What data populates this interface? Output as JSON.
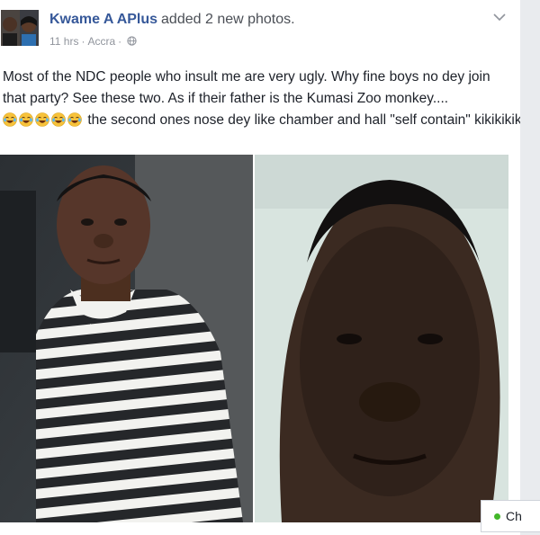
{
  "post": {
    "author_name": "Kwame A APlus",
    "action_text": "added 2 new photos.",
    "time": "11 hrs",
    "separator": "·",
    "location": "Accra",
    "text_line_1": "Most of the NDC people who insult me are very ugly. Why fine boys no dey join that party? See these two. As if their father is the Kumasi Zoo monkey....",
    "text_line_2": "the second ones nose dey like chamber and hall \"self contain\" kikikikiki",
    "emojis": [
      "face-with-tears-of-joy",
      "face-with-tears-of-joy",
      "face-with-tears-of-joy",
      "face-with-tears-of-joy",
      "face-with-tears-of-joy"
    ],
    "photos": [
      "man-in-striped-shirt-photo",
      "man-closeup-face-photo"
    ]
  },
  "chat": {
    "label": "Ch",
    "status_color": "#42b72a"
  },
  "colors": {
    "link": "#365899",
    "meta": "#90949c",
    "text": "#1d2129"
  }
}
